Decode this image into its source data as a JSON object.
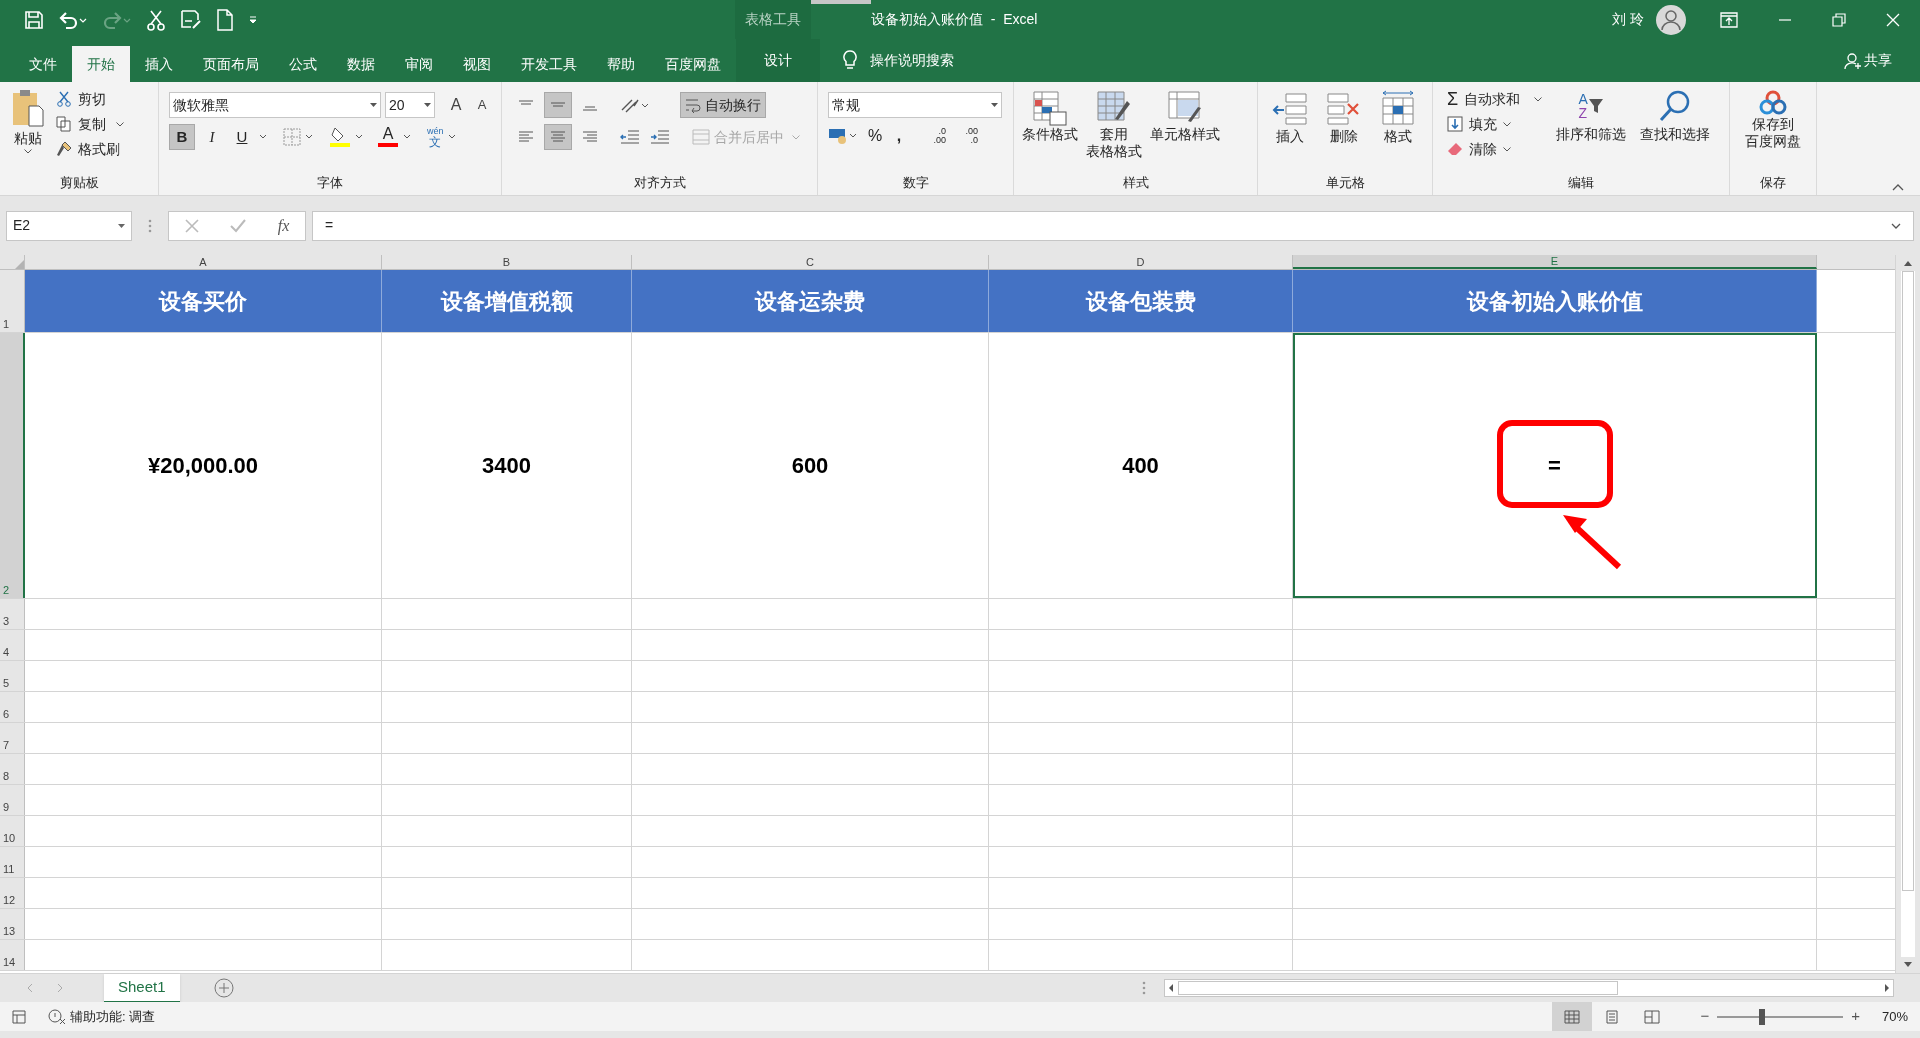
{
  "title_bar": {
    "context_tab_group": "表格工具",
    "title": "设备初始入账价值  -  Excel",
    "user": "刘 玲"
  },
  "ribbon_tabs": [
    {
      "label": "文件",
      "kind": "tab",
      "selected": false
    },
    {
      "label": "开始",
      "kind": "tab",
      "selected": true
    },
    {
      "label": "插入",
      "kind": "tab",
      "selected": false
    },
    {
      "label": "页面布局",
      "kind": "tab",
      "selected": false
    },
    {
      "label": "公式",
      "kind": "tab",
      "selected": false
    },
    {
      "label": "数据",
      "kind": "tab",
      "selected": false
    },
    {
      "label": "审阅",
      "kind": "tab",
      "selected": false
    },
    {
      "label": "视图",
      "kind": "tab",
      "selected": false
    },
    {
      "label": "开发工具",
      "kind": "tab",
      "selected": false
    },
    {
      "label": "帮助",
      "kind": "tab",
      "selected": false
    },
    {
      "label": "百度网盘",
      "kind": "tab",
      "selected": false
    },
    {
      "label": "设计",
      "kind": "context",
      "selected": false
    }
  ],
  "tell_me": "操作说明搜索",
  "share": "共享",
  "ribbon": {
    "clipboard": {
      "label": "剪贴板",
      "paste": "粘贴",
      "cut": "剪切",
      "copy": "复制",
      "format_painter": "格式刷"
    },
    "font": {
      "label": "字体",
      "font_name": "微软雅黑",
      "font_size": "20",
      "grow": "A",
      "shrink": "A",
      "bold": {
        "text": "B",
        "selected": true
      },
      "italic": {
        "text": "I",
        "selected": false
      },
      "underline": {
        "text": "U",
        "selected": false
      },
      "font_color": "A",
      "phonetic_top": "wén",
      "phonetic": "文"
    },
    "alignment": {
      "label": "对齐方式",
      "top_align": {
        "selected": false
      },
      "middle_align": {
        "selected": true
      },
      "bottom_align": {
        "selected": false
      },
      "left_align": {
        "selected": false
      },
      "center_align": {
        "selected": true
      },
      "right_align": {
        "selected": false
      },
      "wrap_text": {
        "text": "自动换行",
        "selected": true
      },
      "merge_center": {
        "text": "合并后居中",
        "disabled": true
      }
    },
    "number": {
      "label": "数字",
      "format": "常规",
      "percent": "%",
      "comma": ",",
      "increase_decimal": {
        "top": ".0",
        "bottom": ".00"
      },
      "decrease_decimal": {
        "top": ".00",
        "bottom": ".0"
      }
    },
    "styles": {
      "label": "样式",
      "conditional": "条件格式",
      "table_format": "套用",
      "table_format_2": "表格格式",
      "cell_styles": "单元格样式"
    },
    "cells": {
      "label": "单元格",
      "insert": "插入",
      "delete": "删除",
      "format": "格式"
    },
    "editing": {
      "label": "编辑",
      "sigma": "Σ",
      "autosum": "自动求和",
      "fill": "填充",
      "clear": "清除",
      "sort_a": "A",
      "sort_z": "Z",
      "sort_filter": "排序和筛选",
      "find_select": "查找和选择"
    },
    "save": {
      "label": "保存",
      "save_to": "保存到",
      "save_to_2": "百度网盘"
    }
  },
  "formula_bar": {
    "name_box": "E2",
    "fx": "fx",
    "formula": "="
  },
  "sheet": {
    "columns": [
      {
        "label": "A",
        "selected": false
      },
      {
        "label": "B",
        "selected": false
      },
      {
        "label": "C",
        "selected": false
      },
      {
        "label": "D",
        "selected": false
      },
      {
        "label": "E",
        "selected": true
      }
    ],
    "rows": [
      {
        "number": "1",
        "kind": "header",
        "selected": false,
        "cells": [
          "设备买价",
          "设备增值税额",
          "设备运杂费",
          "设备包装费",
          "设备初始入账价值"
        ]
      },
      {
        "number": "2",
        "kind": "data",
        "selected": true,
        "cells": [
          "¥20,000.00",
          "3400",
          "600",
          "400",
          "="
        ]
      },
      {
        "number": "3",
        "kind": "empty",
        "selected": false
      },
      {
        "number": "4",
        "kind": "empty",
        "selected": false
      },
      {
        "number": "5",
        "kind": "empty",
        "selected": false
      },
      {
        "number": "6",
        "kind": "empty",
        "selected": false
      },
      {
        "number": "7",
        "kind": "empty",
        "selected": false
      },
      {
        "number": "8",
        "kind": "empty",
        "selected": false
      },
      {
        "number": "9",
        "kind": "empty",
        "selected": false
      },
      {
        "number": "10",
        "kind": "empty",
        "selected": false
      },
      {
        "number": "11",
        "kind": "empty",
        "selected": false
      },
      {
        "number": "12",
        "kind": "empty",
        "selected": false
      },
      {
        "number": "13",
        "kind": "empty",
        "selected": false
      },
      {
        "number": "14",
        "kind": "empty",
        "selected": false
      }
    ]
  },
  "sheet_tabs": [
    {
      "label": "Sheet1",
      "selected": true
    }
  ],
  "status_bar": {
    "accessibility": "辅助功能: 调查",
    "views": [
      {
        "selected": true
      },
      {
        "selected": false
      },
      {
        "selected": false
      }
    ],
    "zoom_slider": {
      "level": 0.35
    },
    "zoom_out": "−",
    "zoom_in": "+",
    "zoom": "70%"
  }
}
